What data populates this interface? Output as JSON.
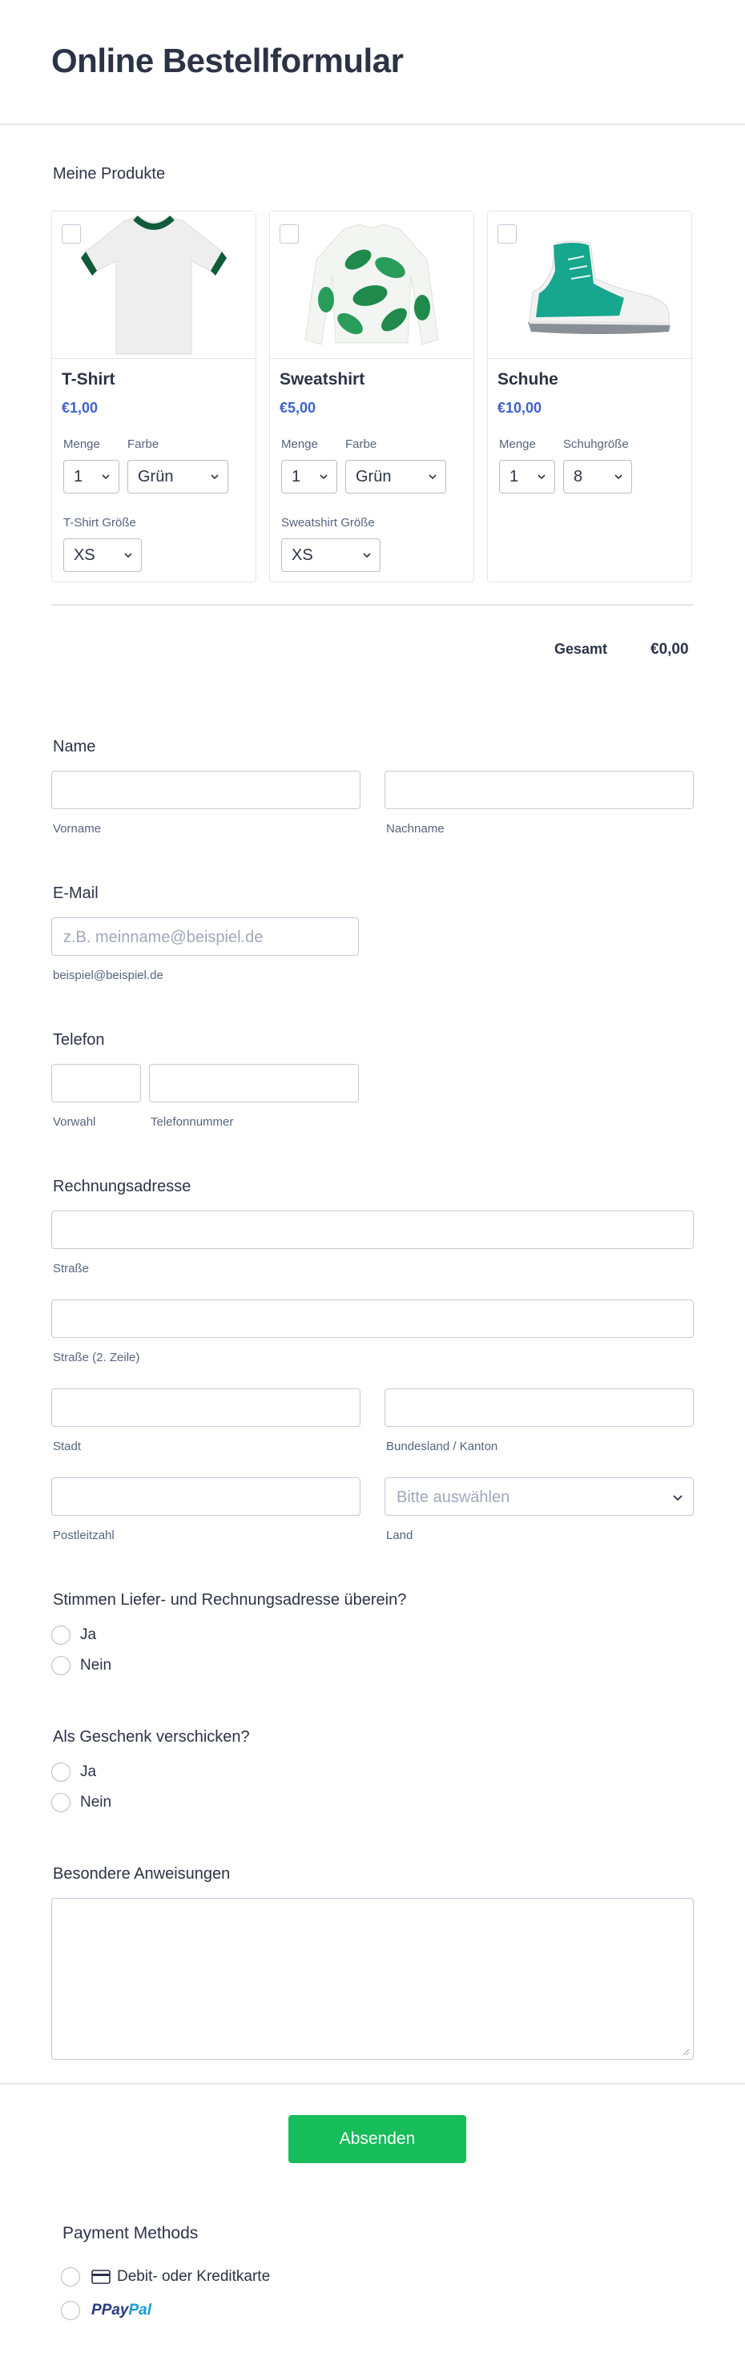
{
  "form": {
    "title": "Online Bestellformular"
  },
  "products": {
    "label": "Meine Produkte",
    "items": [
      {
        "name": "T-Shirt",
        "price": "€1,00",
        "qty_label": "Menge",
        "qty": "1",
        "color_label": "Farbe",
        "color": "Grün",
        "size_label": "T-Shirt Größe",
        "size": "XS"
      },
      {
        "name": "Sweatshirt",
        "price": "€5,00",
        "qty_label": "Menge",
        "qty": "1",
        "color_label": "Farbe",
        "color": "Grün",
        "size_label": "Sweatshirt Größe",
        "size": "XS"
      },
      {
        "name": "Schuhe",
        "price": "€10,00",
        "qty_label": "Menge",
        "qty": "1",
        "size_label": "Schuhgröße",
        "size": "8"
      }
    ],
    "total_label": "Gesamt",
    "total": "€0,00"
  },
  "name": {
    "label": "Name",
    "first_sub": "Vorname",
    "last_sub": "Nachname"
  },
  "email": {
    "label": "E-Mail",
    "placeholder": "z.B. meinname@beispiel.de",
    "sub": "beispiel@beispiel.de"
  },
  "phone": {
    "label": "Telefon",
    "area_sub": "Vorwahl",
    "number_sub": "Telefonnummer"
  },
  "address": {
    "label": "Rechnungsadresse",
    "street_sub": "Straße",
    "street2_sub": "Straße (2. Zeile)",
    "city_sub": "Stadt",
    "state_sub": "Bundesland / Kanton",
    "zip_sub": "Postleitzahl",
    "country_sub": "Land",
    "country_placeholder": "Bitte auswählen"
  },
  "same_address": {
    "label": "Stimmen Liefer- und Rechnungsadresse überein?",
    "options": [
      "Ja",
      "Nein"
    ]
  },
  "gift": {
    "label": "Als Geschenk verschicken?",
    "options": [
      "Ja",
      "Nein"
    ]
  },
  "instructions": {
    "label": "Besondere Anweisungen"
  },
  "submit": {
    "label": "Absenden"
  },
  "payment": {
    "label": "Payment Methods",
    "card_label": "Debit- oder Kreditkarte",
    "paypal_pay": "Pay",
    "paypal_pal": "Pal"
  },
  "colors": {
    "accent": "#18bd5b",
    "price": "#3e62c8",
    "text": "#2c3345",
    "paypal_dark": "#253b80",
    "paypal_light": "#179bd7"
  },
  "icons": [
    "chevron-down-icon",
    "tshirt-image",
    "sweatshirt-image",
    "sneaker-image",
    "credit-card-icon",
    "paypal-logo",
    "resize-grip-icon"
  ]
}
